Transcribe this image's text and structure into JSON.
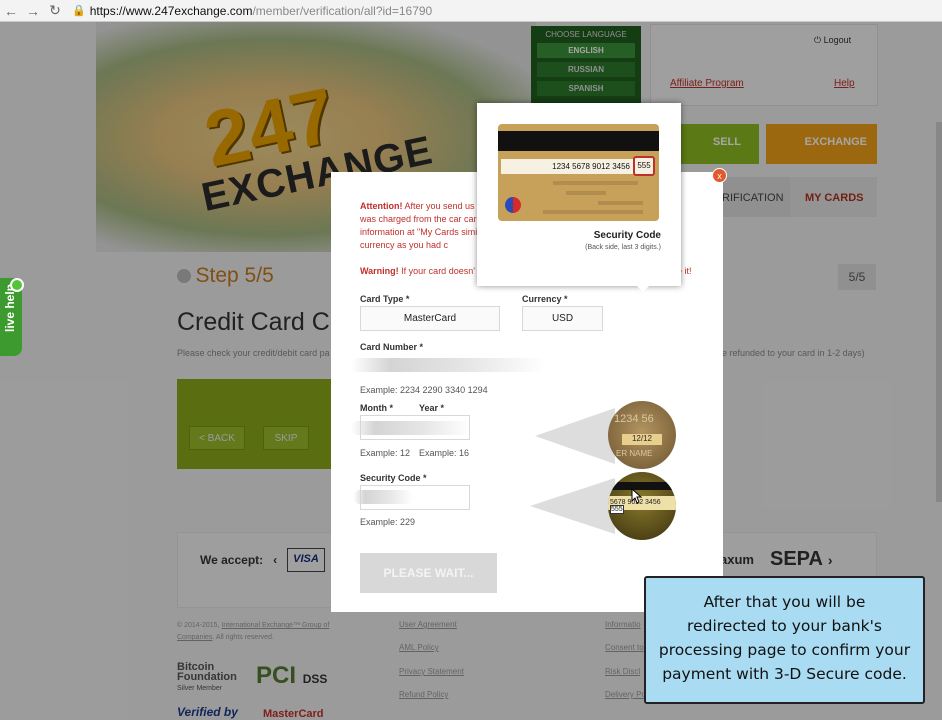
{
  "browser": {
    "url_host": "https://www.247exchange.com",
    "url_path": "/member/verification/all?id=16790"
  },
  "site": {
    "logo_number": "247",
    "logo_word": "EXCHANGE",
    "language_header": "CHOOSE LANGUAGE",
    "languages": [
      "ENGLISH",
      "RUSSIAN",
      "SPANISH"
    ],
    "logout": "Logout",
    "affiliate": "Affiliate Program",
    "help": "Help",
    "tabs": {
      "sell": "SELL",
      "exchange": "EXCHANGE",
      "verification": "RIFICATION",
      "my_cards": "MY CARDS"
    },
    "step_label": "Step 5/5",
    "step_count": "5/5",
    "heading": "Credit Card Co",
    "note_left": "Please check your credit/debit card pa",
    "note_right": "e refunded to your card in 1-2 days)",
    "back_button": "< BACK",
    "skip_button": "SKIP",
    "we_accept": "We accept:",
    "visa": "VISA",
    "xum": "axum",
    "sepa": "SEPA",
    "footer_copy": "© 2014-2015, ",
    "footer_copy_link": "International Exchange™ Group of Companies",
    "footer_copy_tail": ". All rights reserved.",
    "footer_links_col1": [
      "User Agreement",
      "AML Policy",
      "Privacy Statement",
      "Refund Policy"
    ],
    "footer_links_col2": [
      "Informatio",
      "Consent to",
      "Risk Discl",
      "Delivery Po"
    ],
    "bitcoin_logo": "Bitcoin Foundation",
    "bitcoin_sub": "Silver Member",
    "pci_logo": "PCI",
    "pci_sub": "DSS",
    "verified_logo": "Verified by",
    "mastercard_logo": "MasterCard",
    "live_help": "live help"
  },
  "modal": {
    "attention_strong": "Attention!",
    "attention_text": " After you send us v that was charged from the car card information at \"My Cards similar currency as you had c",
    "warning_strong": "Warning!",
    "warning_text": " If your card doesn'",
    "warning_tail": "e it!",
    "card_type_label": "Card Type *",
    "card_type_value": "MasterCard",
    "currency_label": "Currency *",
    "currency_value": "USD",
    "card_number_label": "Card Number *",
    "card_number_example": "Example: 2234 2290 3340 1294",
    "month_label": "Month *",
    "year_label": "Year *",
    "month_example": "Example: 12",
    "year_example": "Example: 16",
    "security_label": "Security Code *",
    "security_example": "Example: 229",
    "submit_label": "PLEASE WAIT...",
    "close": "x"
  },
  "tooltip": {
    "card_number": "1234 5678 9012 3456",
    "cvv": "555",
    "title": "Security Code",
    "subtitle": "(Back side, last 3 digits.)"
  },
  "zoom_circles": {
    "expiry_digits": "1234 56",
    "expiry_date": "12/12",
    "name": "ER NAME",
    "cvv_digits": "5678 9012 3456",
    "cvv": "555"
  },
  "callout": {
    "lines": [
      "After that you will be",
      "redirected to your bank's",
      "processing page to confirm your",
      "payment with 3-D Secure code."
    ]
  },
  "colors": {
    "accent_red": "#c0302a",
    "callout_bg": "#a9dcf2",
    "sell_green": "#8dbb1f",
    "exchange_orange": "#f0a018"
  }
}
